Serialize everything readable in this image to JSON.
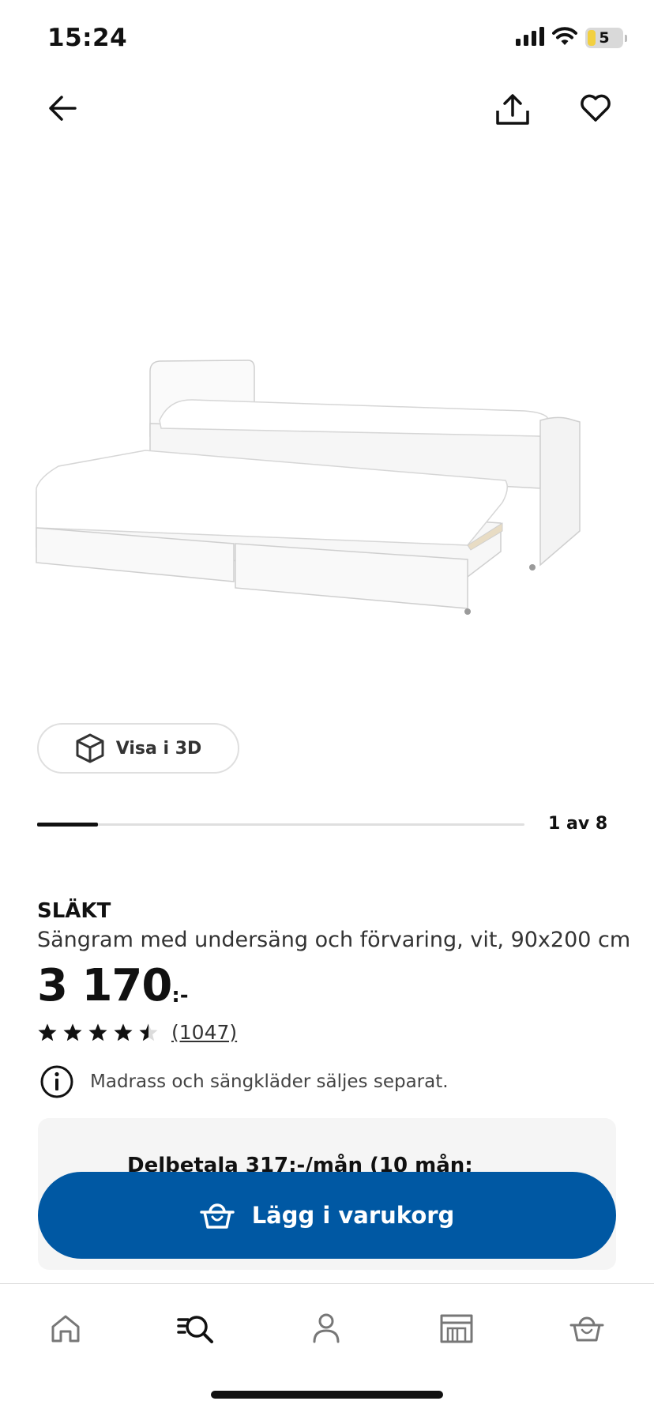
{
  "status_bar": {
    "time": "15:24",
    "battery": "5",
    "icons": [
      "signal-icon",
      "wifi-icon",
      "battery-icon"
    ]
  },
  "top_nav": {
    "icons": [
      "back-arrow-icon",
      "share-icon",
      "heart-icon"
    ]
  },
  "view_3d_button": {
    "label": "Visa i 3D",
    "icon": "cube-icon"
  },
  "gallery": {
    "counter": "1 av 8",
    "current": 1,
    "total": 8
  },
  "product": {
    "name": "SLÄKT",
    "description": "Sängram med undersäng och förvaring, vit, 90x200 cm",
    "price": "3 170",
    "price_suffix": ":-",
    "rating": 4.5,
    "rating_max": 5,
    "review_count": "(1047)",
    "notice": "Madrass och sängkläder säljes separat.",
    "notice_icon": "info-icon"
  },
  "installment": {
    "text": "Delbetala 317:-/mån (10 mån;"
  },
  "cart_button": {
    "label": "Lägg i varukorg",
    "icon": "basket-icon"
  },
  "tab_bar": {
    "tabs": [
      {
        "name": "home",
        "icon": "home-icon"
      },
      {
        "name": "search",
        "icon": "search-icon",
        "active": true
      },
      {
        "name": "profile",
        "icon": "person-icon"
      },
      {
        "name": "store",
        "icon": "store-icon"
      },
      {
        "name": "cart",
        "icon": "basket-icon"
      }
    ]
  },
  "colors": {
    "brand_blue": "#0058a3",
    "text": "#111111",
    "panel_bg": "#f5f5f5",
    "battery_yellow": "#f2d040"
  }
}
